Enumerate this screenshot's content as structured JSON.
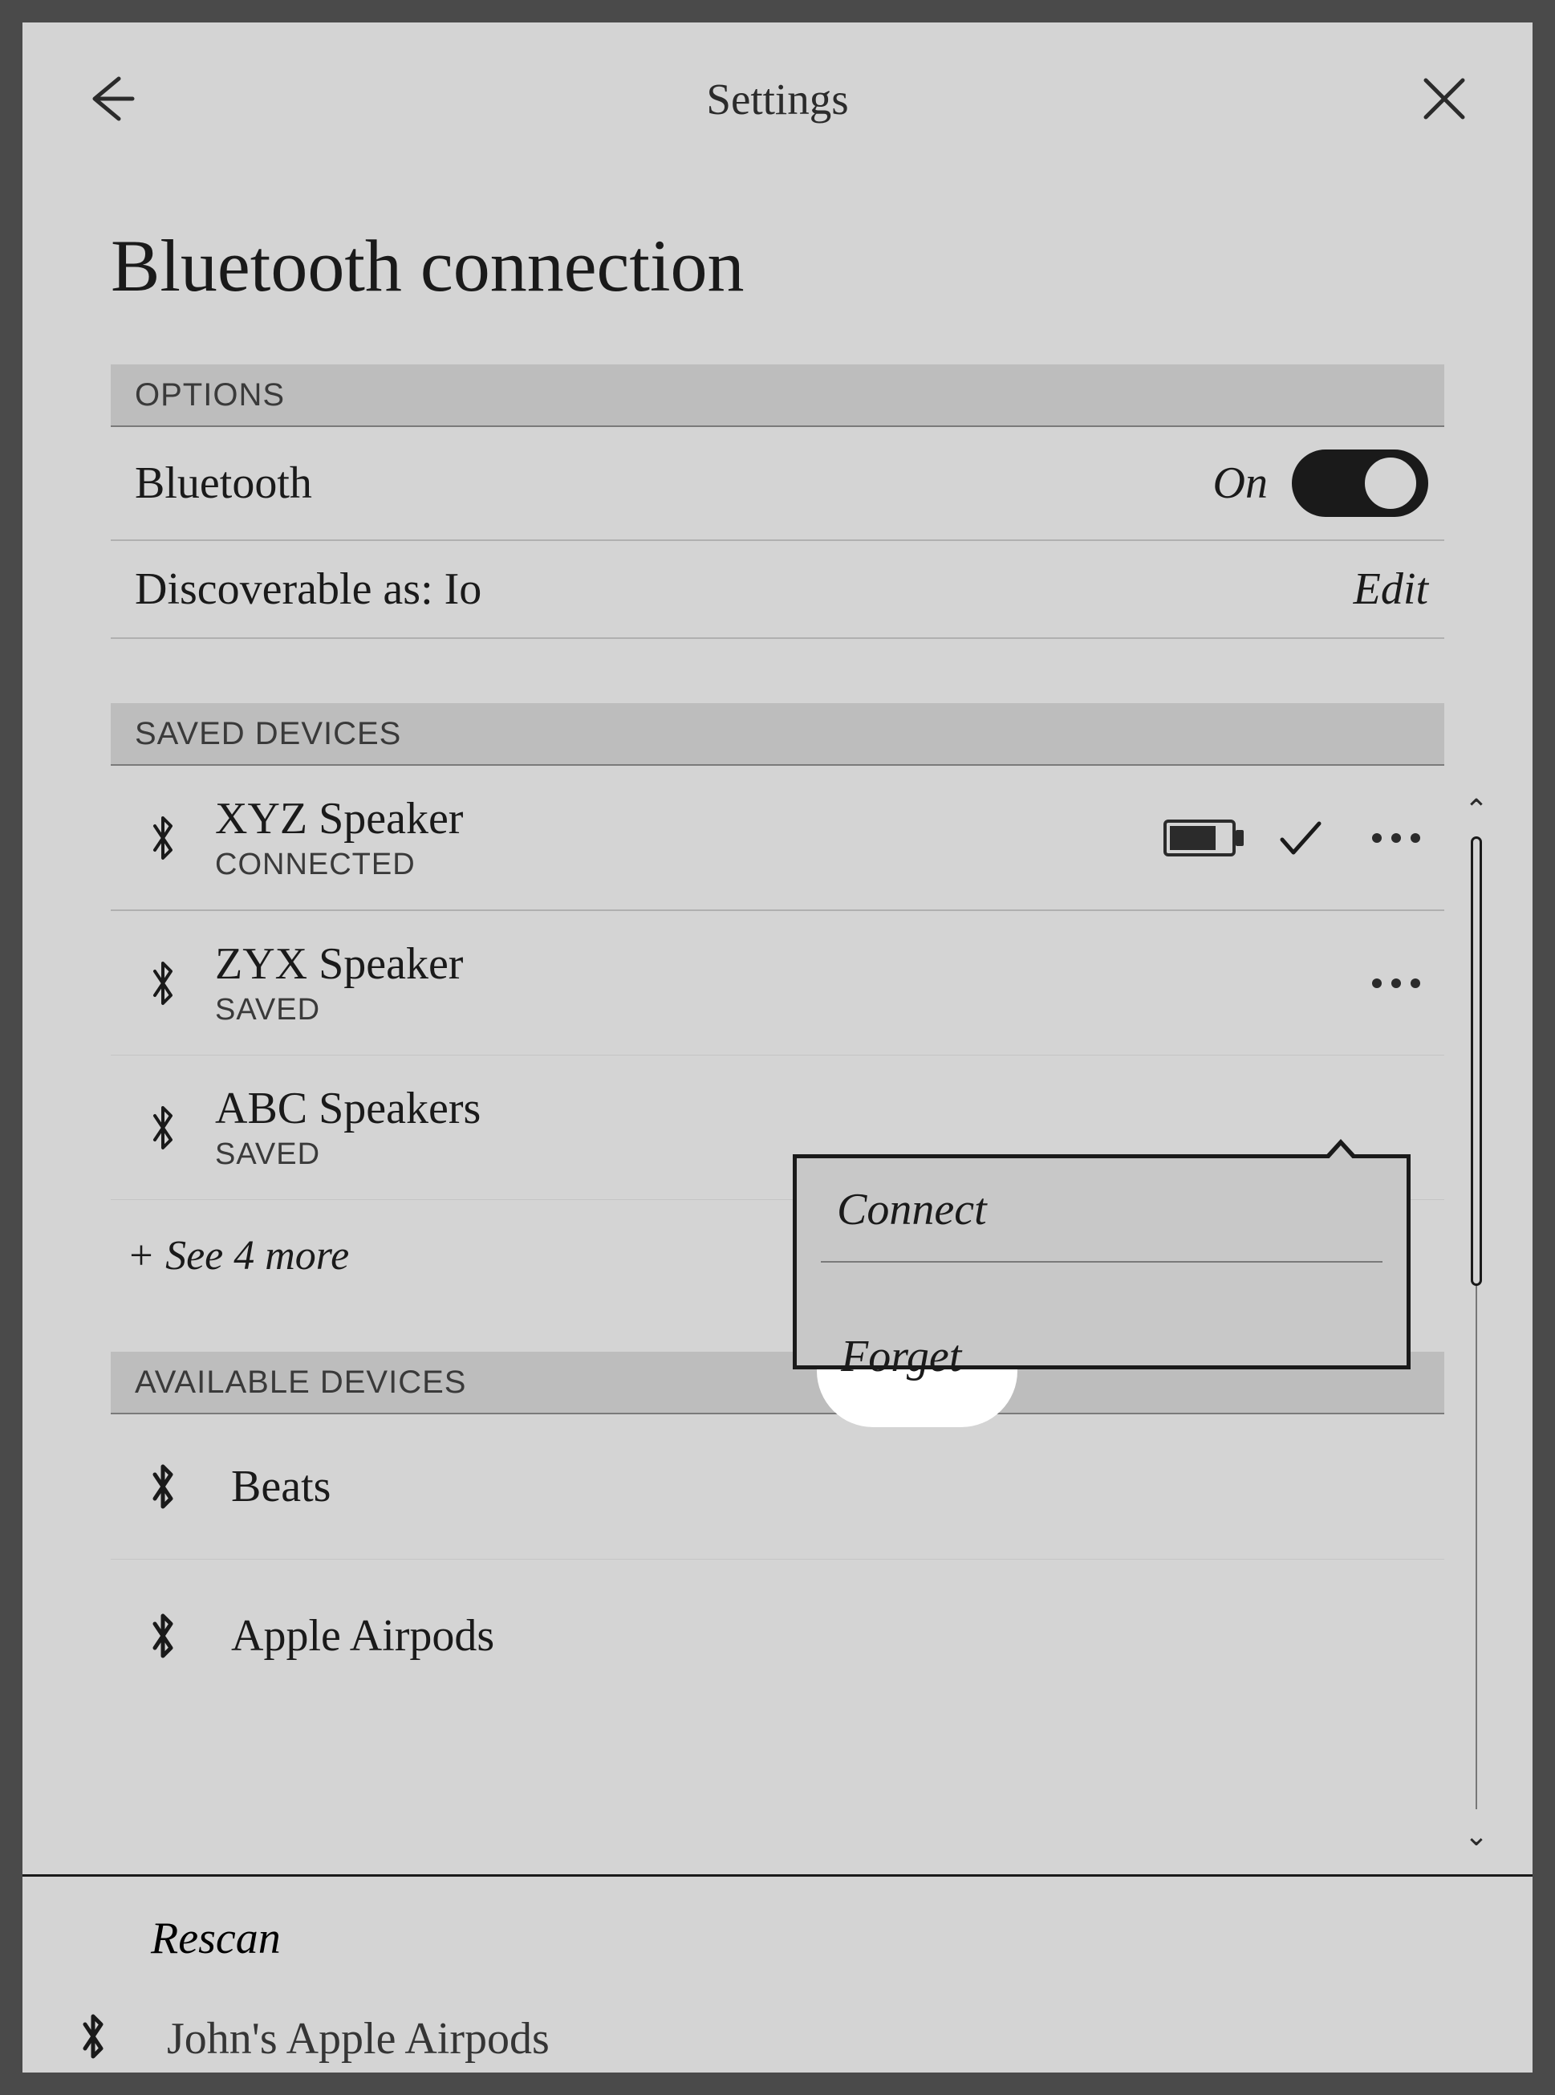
{
  "header": {
    "title": "Settings"
  },
  "page": {
    "title": "Bluetooth connection"
  },
  "sections": {
    "options": "OPTIONS",
    "saved": "SAVED DEVICES",
    "available": "AVAILABLE DEVICES"
  },
  "bluetooth_row": {
    "label": "Bluetooth",
    "state_label": "On",
    "on": true
  },
  "discoverable_row": {
    "label": "Discoverable as: Io",
    "action": "Edit"
  },
  "saved_devices": [
    {
      "name": "XYZ Speaker",
      "status": "CONNECTED",
      "battery": true,
      "connected": true
    },
    {
      "name": "ZYX Speaker",
      "status": "SAVED",
      "battery": false,
      "connected": false
    },
    {
      "name": "ABC Speakers",
      "status": "SAVED",
      "battery": false,
      "connected": false
    }
  ],
  "see_more": "+ See 4 more",
  "available_devices": [
    {
      "name": "Beats"
    },
    {
      "name": "Apple Airpods"
    },
    {
      "name": "John's Apple Airpods"
    }
  ],
  "popup": {
    "connect": "Connect",
    "forget": "Forget"
  },
  "rescan": "Rescan"
}
